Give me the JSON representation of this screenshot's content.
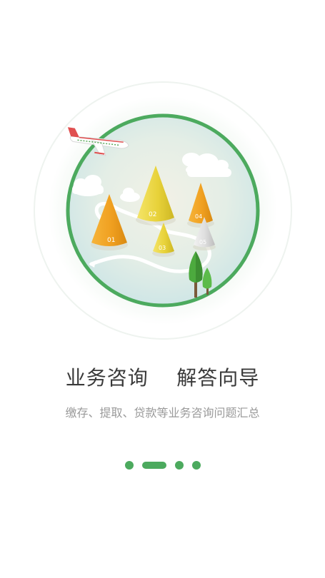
{
  "onboarding": {
    "headline": "业务咨询    解答向导",
    "subline": "缴存、提取、贷款等业务咨询问题汇总"
  },
  "illustration": {
    "cone_labels": [
      "01",
      "02",
      "03",
      "04",
      "05"
    ],
    "accent_color": "#4caa5e",
    "icons": [
      "airplane-icon",
      "cloud-icon",
      "tree-icon",
      "cone-marker-icon"
    ]
  },
  "pager": {
    "count": 4,
    "active_index": 1
  }
}
